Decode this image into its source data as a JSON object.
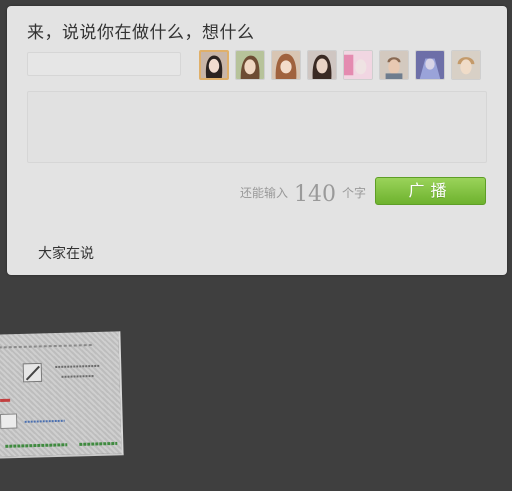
{
  "composer": {
    "title": "来，说说你在做什么，想什么",
    "name_placeholder": "",
    "message_placeholder": "",
    "counter_prefix": "还能输入",
    "counter_value": "140",
    "counter_suffix": "个字",
    "submit_label": "广播"
  },
  "avatars": [
    {
      "label": "avatar-1",
      "selected": true
    },
    {
      "label": "avatar-2",
      "selected": false
    },
    {
      "label": "avatar-3",
      "selected": false
    },
    {
      "label": "avatar-4",
      "selected": false
    },
    {
      "label": "avatar-5",
      "selected": false
    },
    {
      "label": "avatar-6",
      "selected": false
    },
    {
      "label": "avatar-7",
      "selected": false
    },
    {
      "label": "avatar-8",
      "selected": false
    }
  ],
  "feed": {
    "heading": "大家在说"
  },
  "colors": {
    "panel_bg": "#e3e3e3",
    "page_bg": "#3f3f3f",
    "accent_green": "#7cbf3a",
    "selected_border": "#e0b06a"
  }
}
